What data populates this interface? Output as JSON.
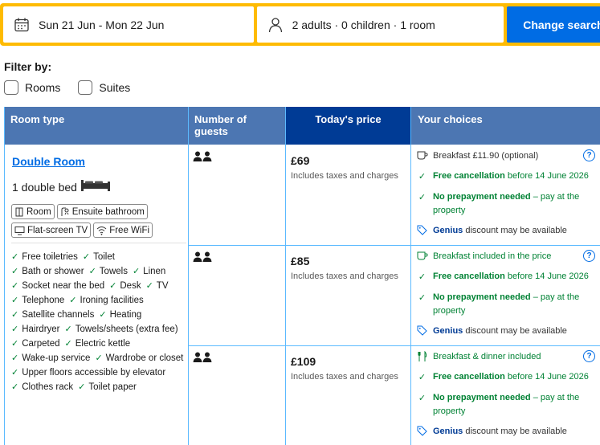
{
  "search": {
    "dates": "Sun 21 Jun - Mon 22 Jun",
    "occupancy": "2 adults · 0 children · 1 room",
    "button": "Change search"
  },
  "filter": {
    "title": "Filter by:",
    "options": [
      "Rooms",
      "Suites"
    ]
  },
  "table": {
    "headers": {
      "room_type": "Room type",
      "guests": "Number of guests",
      "price": "Today's price",
      "choices": "Your choices"
    }
  },
  "room": {
    "name": "Double Room",
    "bed": "1 double bed",
    "tags": [
      "Room",
      "Ensuite bathroom",
      "Flat-screen TV",
      "Free WiFi"
    ],
    "facilities": [
      "Free toiletries",
      "Toilet",
      "Bath or shower",
      "Towels",
      "Linen",
      "Socket near the bed",
      "Desk",
      "TV",
      "Telephone",
      "Ironing facilities",
      "Satellite channels",
      "Heating",
      "Hairdryer",
      "Towels/sheets (extra fee)",
      "Carpeted",
      "Electric kettle",
      "Wake-up service",
      "Wardrobe or closet",
      "Upper floors accessible by elevator",
      "Clothes rack",
      "Toilet paper"
    ]
  },
  "options": [
    {
      "price": "£69",
      "price_note": "Includes taxes and charges",
      "meal": "Breakfast £11.90 (optional)",
      "cancel_bold": "Free cancellation",
      "cancel_rest": " before 14 June 2026",
      "prepay_bold": "No prepayment needed",
      "prepay_rest": " – pay at the property",
      "genius_bold": "Genius",
      "genius_rest": " discount may be available",
      "info": "?"
    },
    {
      "price": "£85",
      "price_note": "Includes taxes and charges",
      "meal": "Breakfast included in the price",
      "cancel_bold": "Free cancellation",
      "cancel_rest": " before 14 June 2026",
      "prepay_bold": "No prepayment needed",
      "prepay_rest": " – pay at the property",
      "genius_bold": "Genius",
      "genius_rest": " discount may be available",
      "info": "?"
    },
    {
      "price": "£109",
      "price_note": "Includes taxes and charges",
      "meal": "Breakfast & dinner included",
      "cancel_bold": "Free cancellation",
      "cancel_rest": " before 14 June 2026",
      "prepay_bold": "No prepayment needed",
      "prepay_rest": " – pay at the property",
      "genius_bold": "Genius",
      "genius_rest": " discount may be available",
      "info": "?"
    }
  ],
  "colors": {
    "brand_blue": "#006ce4",
    "dark_blue": "#003b95",
    "header_blue": "#4c76b2",
    "search_yellow": "#febb02",
    "green": "#008234",
    "grid_line": "#5bbaff"
  }
}
